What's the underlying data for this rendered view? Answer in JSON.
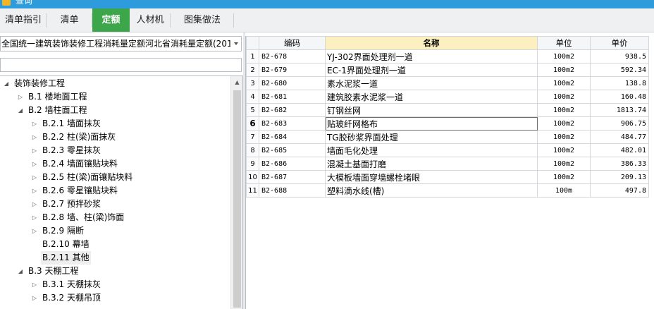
{
  "window": {
    "title": "查询"
  },
  "tabs": [
    {
      "label": "清单指引"
    },
    {
      "label": "清单"
    },
    {
      "label": "定额",
      "active": true
    },
    {
      "label": "人材机"
    },
    {
      "label": "图集做法"
    }
  ],
  "left": {
    "quota_library": "全国统一建筑装饰装修工程消耗量定额河北省消耗量定额(201",
    "filter_value": "",
    "tree": [
      {
        "label": "装饰装修工程",
        "level": 0,
        "state": "expanded"
      },
      {
        "label": "B.1 楼地面工程",
        "level": 1,
        "state": "collapsed"
      },
      {
        "label": "B.2 墙柱面工程",
        "level": 1,
        "state": "expanded"
      },
      {
        "label": "B.2.1 墙面抹灰",
        "level": 2,
        "state": "collapsed"
      },
      {
        "label": "B.2.2 柱(梁)面抹灰",
        "level": 2,
        "state": "collapsed"
      },
      {
        "label": "B.2.3 零星抹灰",
        "level": 2,
        "state": "collapsed"
      },
      {
        "label": "B.2.4 墙面镶贴块料",
        "level": 2,
        "state": "collapsed"
      },
      {
        "label": "B.2.5 柱(梁)面镶贴块料",
        "level": 2,
        "state": "collapsed"
      },
      {
        "label": "B.2.6 零星镶贴块料",
        "level": 2,
        "state": "collapsed"
      },
      {
        "label": "B.2.7 预拌砂浆",
        "level": 2,
        "state": "collapsed"
      },
      {
        "label": "B.2.8 墙、柱(梁)饰面",
        "level": 2,
        "state": "collapsed"
      },
      {
        "label": "B.2.9 隔断",
        "level": 2,
        "state": "collapsed"
      },
      {
        "label": "B.2.10 幕墙",
        "level": 2,
        "state": "leaf"
      },
      {
        "label": "B.2.11 其他",
        "level": 2,
        "state": "leaf",
        "selected": true
      },
      {
        "label": "B.3 天棚工程",
        "level": 1,
        "state": "expanded"
      },
      {
        "label": "B.3.1 天棚抹灰",
        "level": 2,
        "state": "collapsed"
      },
      {
        "label": "B.3.2 天棚吊顶",
        "level": 2,
        "state": "collapsed"
      }
    ]
  },
  "grid": {
    "columns": {
      "code": "编码",
      "name": "名称",
      "unit": "单位",
      "price": "单价"
    },
    "current_row": 6,
    "rows": [
      {
        "idx": "1",
        "code": "B2-678",
        "name": "YJ-302界面处理剂一道",
        "unit": "100m2",
        "price": "938.5"
      },
      {
        "idx": "2",
        "code": "B2-679",
        "name": "EC-1界面处理剂一道",
        "unit": "100m2",
        "price": "592.34"
      },
      {
        "idx": "3",
        "code": "B2-680",
        "name": "素水泥浆一道",
        "unit": "100m2",
        "price": "138.8"
      },
      {
        "idx": "4",
        "code": "B2-681",
        "name": "建筑胶素水泥浆一道",
        "unit": "100m2",
        "price": "160.48"
      },
      {
        "idx": "5",
        "code": "B2-682",
        "name": "钉钢丝网",
        "unit": "100m2",
        "price": "1813.74"
      },
      {
        "idx": "6",
        "code": "B2-683",
        "name": "贴玻纤网格布",
        "unit": "100m2",
        "price": "906.75"
      },
      {
        "idx": "7",
        "code": "B2-684",
        "name": "TG胶砂浆界面处理",
        "unit": "100m2",
        "price": "484.77"
      },
      {
        "idx": "8",
        "code": "B2-685",
        "name": "墙面毛化处理",
        "unit": "100m2",
        "price": "482.01"
      },
      {
        "idx": "9",
        "code": "B2-686",
        "name": "混凝土基面打磨",
        "unit": "100m2",
        "price": "386.33"
      },
      {
        "idx": "10",
        "code": "B2-687",
        "name": "大模板墙面穿墙螺栓堵眼",
        "unit": "100m2",
        "price": "209.13"
      },
      {
        "idx": "11",
        "code": "B2-688",
        "name": "塑料滴水线(槽)",
        "unit": "100m",
        "price": "497.8"
      }
    ]
  }
}
